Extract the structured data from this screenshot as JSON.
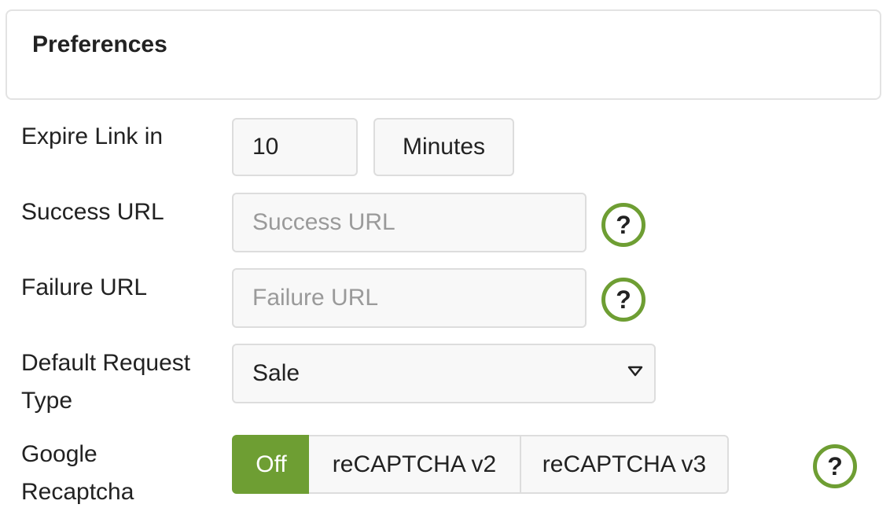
{
  "panel": {
    "title": "Preferences"
  },
  "expire": {
    "label": "Expire Link in",
    "value": "10",
    "unit": "Minutes"
  },
  "success_url": {
    "label": "Success URL",
    "placeholder": "Success URL",
    "help_symbol": "?"
  },
  "failure_url": {
    "label": "Failure URL",
    "placeholder": "Failure URL",
    "help_symbol": "?"
  },
  "default_request_type": {
    "label_line1": "Default Request",
    "label_line2": "Type",
    "selected": "Sale"
  },
  "recaptcha": {
    "label_line1": "Google",
    "label_line2": "Recaptcha",
    "options": [
      "Off",
      "reCAPTCHA v2",
      "reCAPTCHA v3"
    ],
    "selected": "Off",
    "help_symbol": "?"
  },
  "colors": {
    "accent": "#6e9e33",
    "border": "#dddddd",
    "field_bg": "#f8f8f8",
    "placeholder": "#9a9a9a"
  },
  "icons": {
    "help": "question-circle-icon",
    "dropdown": "caret-down-icon"
  }
}
